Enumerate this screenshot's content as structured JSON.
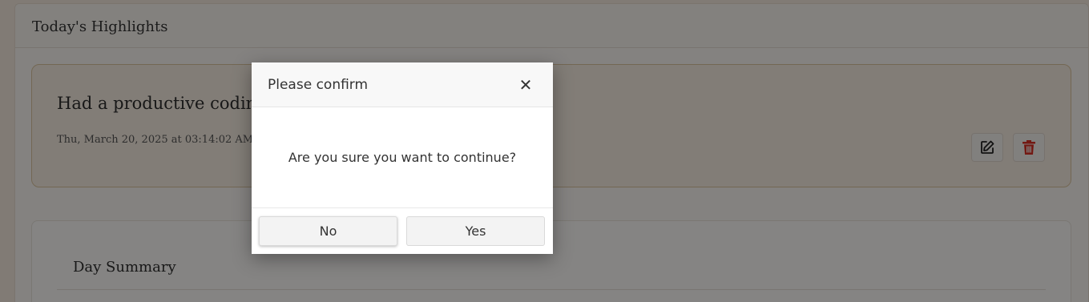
{
  "section": {
    "title": "Today's Highlights"
  },
  "highlight": {
    "title": "Had a productive coding",
    "date": "Thu, March 20, 2025 at 03:14:02 AM",
    "edit_icon": "edit-icon",
    "delete_icon": "trash-icon"
  },
  "summary": {
    "title": "Day Summary"
  },
  "modal": {
    "title": "Please confirm",
    "close_icon": "close-icon",
    "close_glyph": "✕",
    "message": "Are you sure you want to continue?",
    "no_label": "No",
    "yes_label": "Yes"
  },
  "colors": {
    "delete_red": "#d93025",
    "overlay": "rgba(0,0,0,0.47)",
    "highlight_border": "#d9c39d"
  }
}
